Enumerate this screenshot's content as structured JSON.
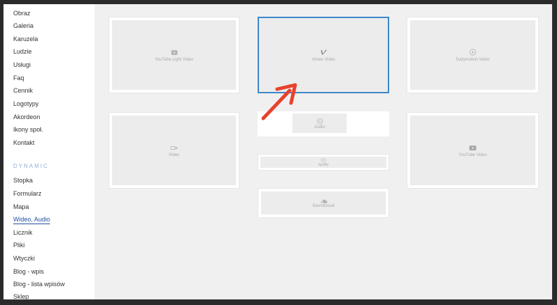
{
  "sidebar": {
    "items": [
      "Obraz",
      "Galeria",
      "Karuzela",
      "Ludzie",
      "Usługi",
      "Faq",
      "Cennik",
      "Logotypy",
      "Akordeon",
      "Ikony społ.",
      "Kontakt"
    ],
    "section_title": "DYNAMIC",
    "dynamic_items": [
      "Stopka",
      "Formularz",
      "Mapa",
      "Wideo, Audio",
      "Licznik",
      "Pliki",
      "Wtyczki",
      "Blog - wpis",
      "Blog - lista wpisów",
      "Sklep"
    ],
    "active": "Wideo, Audio"
  },
  "blocks": {
    "youtube_light": "YouTube Light Video",
    "vimeo": "Vimeo Video",
    "dailymotion": "Dailymotion Video",
    "audio": "Audio",
    "video": "Video",
    "youtube": "YouTube Video",
    "spotify": "Spotify",
    "soundcloud": "Soundcloud"
  },
  "colors": {
    "selected_border": "#3e87c8",
    "arrow": "#e8412c",
    "active_link": "#1f4fa0"
  },
  "icons": {
    "youtube_light": "youtube-icon",
    "vimeo": "vimeo-icon",
    "dailymotion": "play-circle-icon",
    "audio": "play-circle-icon",
    "video": "video-camera-icon",
    "youtube": "youtube-icon",
    "spotify": "spotify-icon",
    "soundcloud": "soundcloud-icon"
  }
}
